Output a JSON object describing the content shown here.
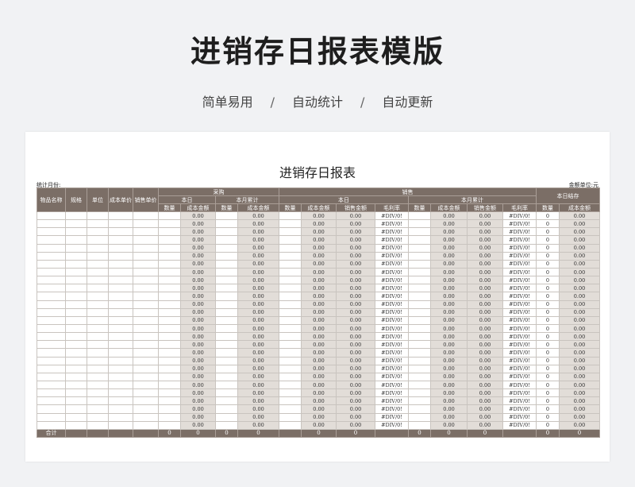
{
  "header": {
    "title": "进销存日报表模版",
    "features": [
      "简单易用",
      "自动统计",
      "自动更新"
    ],
    "separator": "/"
  },
  "sheet": {
    "title": "进销存日报表",
    "meta_left": "统计月份:",
    "meta_right": "金额单位:元",
    "columns": {
      "item_name": "物品名称",
      "spec": "规格",
      "unit": "单位",
      "cost_price": "成本单价",
      "sale_price": "销售单价",
      "purchase": "采购",
      "sales": "销售",
      "today": "本日",
      "month_total": "本月累计",
      "day_end_stock": "本日结存",
      "qty": "数量",
      "cost_amount": "成本金额",
      "sale_amount": "销售金额",
      "margin_rate": "毛利率"
    },
    "row_count": 27,
    "row_values": {
      "zero_amount": "0.00",
      "div_error": "#DIV/0!",
      "zero": "0"
    },
    "footer": {
      "label": "合计",
      "values": [
        "",
        "",
        "",
        "",
        "0",
        "0",
        "0",
        "0",
        "",
        "0",
        "0",
        "",
        "0",
        "0",
        "0",
        "",
        "0",
        "0"
      ]
    }
  }
}
